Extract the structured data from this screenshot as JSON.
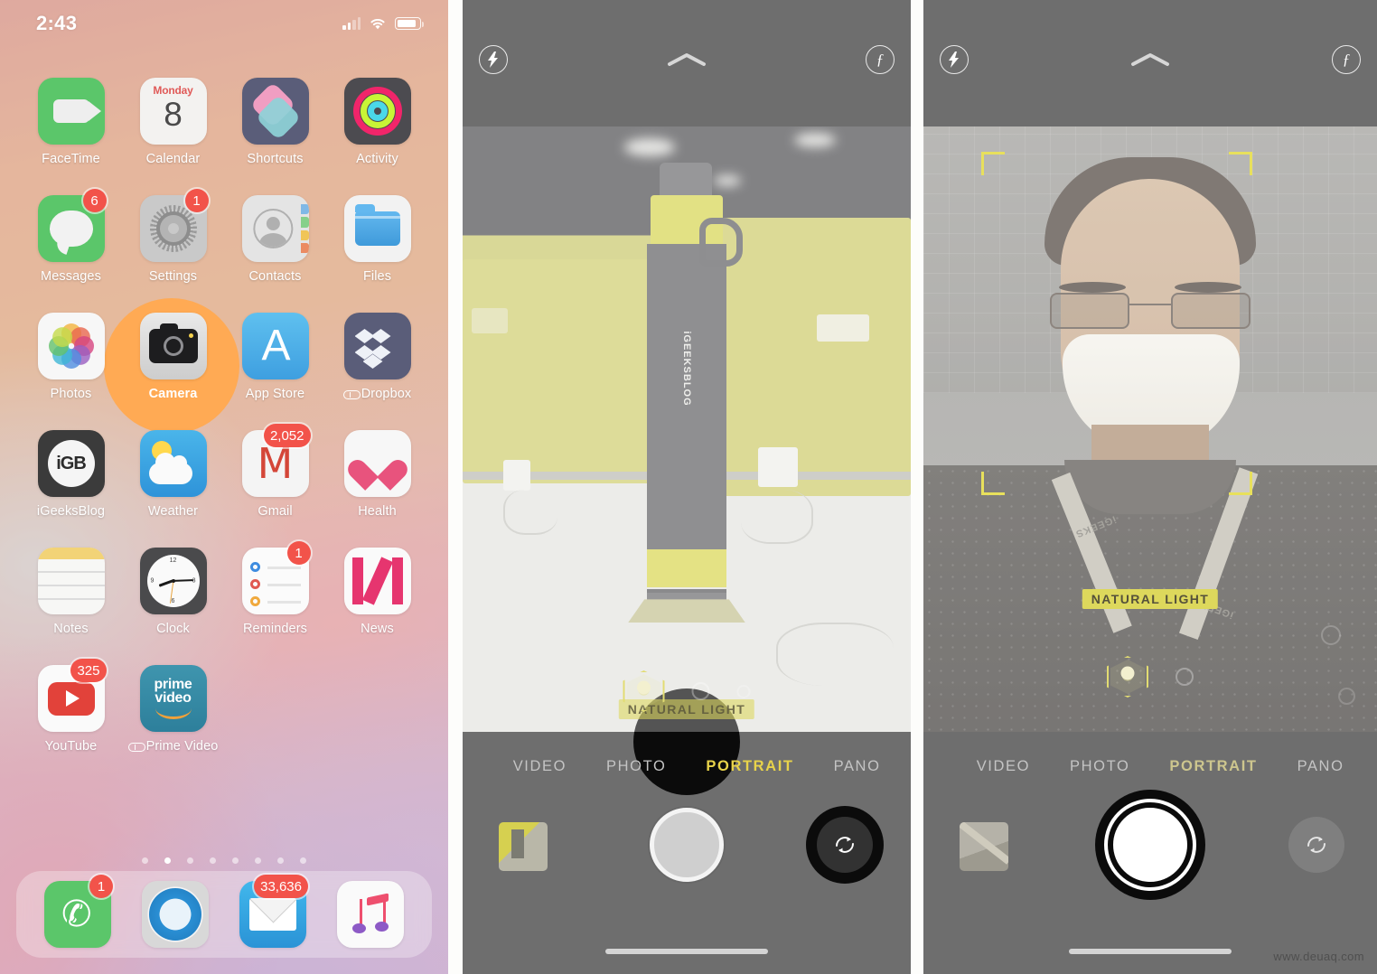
{
  "status_bar": {
    "time": "2:43",
    "signal_icon": "cellular-bars-icon",
    "wifi_icon": "wifi-icon",
    "battery_icon": "battery-icon"
  },
  "home_screen": {
    "apps": [
      {
        "label": "FaceTime",
        "badge": null,
        "icon": "facetime-icon"
      },
      {
        "label": "Calendar",
        "badge": null,
        "icon": "calendar-icon",
        "day": "Monday",
        "date": "8"
      },
      {
        "label": "Shortcuts",
        "badge": null,
        "icon": "shortcuts-icon"
      },
      {
        "label": "Activity",
        "badge": null,
        "icon": "activity-icon"
      },
      {
        "label": "Messages",
        "badge": "6",
        "icon": "messages-icon"
      },
      {
        "label": "Settings",
        "badge": "1",
        "icon": "settings-icon"
      },
      {
        "label": "Contacts",
        "badge": null,
        "icon": "contacts-icon"
      },
      {
        "label": "Files",
        "badge": null,
        "icon": "files-icon"
      },
      {
        "label": "Photos",
        "badge": null,
        "icon": "photos-icon"
      },
      {
        "label": "Camera",
        "badge": null,
        "icon": "camera-icon",
        "highlighted": true
      },
      {
        "label": "App Store",
        "badge": null,
        "icon": "app-store-icon"
      },
      {
        "label": "Dropbox",
        "badge": null,
        "icon": "dropbox-icon",
        "cloud": true
      },
      {
        "label": "iGeeksBlog",
        "badge": null,
        "icon": "igeeksblog-icon"
      },
      {
        "label": "Weather",
        "badge": null,
        "icon": "weather-icon"
      },
      {
        "label": "Gmail",
        "badge": "2,052",
        "icon": "gmail-icon"
      },
      {
        "label": "Health",
        "badge": null,
        "icon": "health-icon"
      },
      {
        "label": "Notes",
        "badge": null,
        "icon": "notes-icon"
      },
      {
        "label": "Clock",
        "badge": null,
        "icon": "clock-icon"
      },
      {
        "label": "Reminders",
        "badge": "1",
        "icon": "reminders-icon"
      },
      {
        "label": "News",
        "badge": null,
        "icon": "news-icon"
      },
      {
        "label": "YouTube",
        "badge": "325",
        "icon": "youtube-icon"
      },
      {
        "label": "Prime Video",
        "badge": null,
        "icon": "prime-video-icon",
        "cloud": true
      }
    ],
    "page_dots": {
      "count": 8,
      "active_index": 1
    },
    "dock": [
      {
        "label": "Phone",
        "badge": "1",
        "icon": "phone-icon"
      },
      {
        "label": "Safari",
        "badge": null,
        "icon": "safari-icon"
      },
      {
        "label": "Mail",
        "badge": "33,636",
        "icon": "mail-icon"
      },
      {
        "label": "Music",
        "badge": null,
        "icon": "music-icon"
      }
    ],
    "highlight_color": "#ff8000",
    "badge_color": "#f2534a"
  },
  "camera_rear": {
    "top_controls": {
      "flash_icon": "flash-icon",
      "expand_icon": "chevron-up-icon",
      "depth_icon": "f-stop-icon",
      "depth_label": "ƒ"
    },
    "lighting_label": "NATURAL LIGHT",
    "lighting_picker_icon": "portrait-lighting-cube-icon",
    "modes": [
      "VIDEO",
      "PHOTO",
      "PORTRAIT",
      "PANO"
    ],
    "active_mode": "PORTRAIT",
    "bottom_controls": {
      "thumbnail_icon": "last-photo-thumbnail",
      "shutter_icon": "shutter-button",
      "flip_icon": "flip-camera-icon"
    },
    "subject_brand_text": "iGEEKSBLOG",
    "highlight_target": "flip-camera-button",
    "home_indicator": "home-indicator"
  },
  "camera_front": {
    "top_controls": {
      "flash_icon": "flash-icon",
      "expand_icon": "chevron-up-icon",
      "depth_icon": "f-stop-icon",
      "depth_label": "ƒ"
    },
    "face_box_icon": "face-detection-brackets",
    "lighting_label": "NATURAL LIGHT",
    "lighting_picker_icon": "portrait-lighting-cube-icon",
    "modes": [
      "VIDEO",
      "PHOTO",
      "PORTRAIT",
      "PANO"
    ],
    "active_mode": "PORTRAIT",
    "bottom_controls": {
      "thumbnail_icon": "last-photo-thumbnail",
      "shutter_icon": "shutter-button",
      "flip_icon": "flip-camera-icon"
    },
    "lanyard_text": "iGEEKS",
    "highlight_target": "shutter-button",
    "home_indicator": "home-indicator"
  },
  "watermark": "www.deuaq.com",
  "accent_colors": {
    "portrait_yellow": "#e8d34a",
    "lighting_label_bg": "#ddd85c",
    "face_bracket": "#e8e05c",
    "camera_chrome": "#6e6e6e"
  }
}
